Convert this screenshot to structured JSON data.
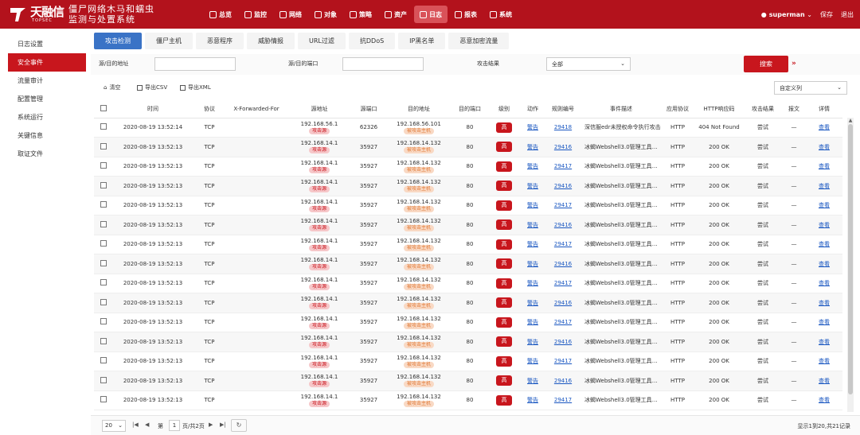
{
  "brand": {
    "logo_cn": "天融信",
    "logo_en": "TOPSEC",
    "product_line1": "僵尸网络木马和蠕虫",
    "product_line2": "监测与处置系统",
    "color": "#b3121c"
  },
  "topnav": [
    {
      "label": "总览",
      "icon": "dashboard-icon"
    },
    {
      "label": "监控",
      "icon": "monitor-icon"
    },
    {
      "label": "网络",
      "icon": "network-icon"
    },
    {
      "label": "对象",
      "icon": "object-icon"
    },
    {
      "label": "策略",
      "icon": "shield-icon"
    },
    {
      "label": "资产",
      "icon": "asset-icon"
    },
    {
      "label": "日志",
      "icon": "log-icon",
      "active": true
    },
    {
      "label": "报表",
      "icon": "report-icon"
    },
    {
      "label": "系统",
      "icon": "gear-icon"
    }
  ],
  "user": {
    "name": "superman",
    "save": "保存",
    "logout": "退出"
  },
  "sidebar": [
    {
      "label": "日志设置"
    },
    {
      "label": "安全事件",
      "active": true
    },
    {
      "label": "流量审计"
    },
    {
      "label": "配置管理"
    },
    {
      "label": "系统运行"
    },
    {
      "label": "关键信息"
    },
    {
      "label": "取证文件"
    }
  ],
  "tabs": [
    {
      "label": "攻击检测",
      "active": true
    },
    {
      "label": "僵尸主机"
    },
    {
      "label": "恶意程序"
    },
    {
      "label": "威胁情报"
    },
    {
      "label": "URL过滤"
    },
    {
      "label": "抗DDoS"
    },
    {
      "label": "IP黑名单"
    },
    {
      "label": "恶意加密流量"
    }
  ],
  "filter": {
    "src_dst_addr_label": "源/目的地址",
    "src_dst_port_label": "源/目的端口",
    "result_label": "攻击结果",
    "result_value": "全部",
    "search": "搜索"
  },
  "toolbar": {
    "clear": "清空",
    "export_csv": "导出CSV",
    "export_xml": "导出XML",
    "custom_columns": "自定义列"
  },
  "columns": [
    "时间",
    "协议",
    "X-Forwarded-For",
    "源地址",
    "源端口",
    "目的地址",
    "目的端口",
    "级别",
    "动作",
    "规则编号",
    "事件描述",
    "应用协议",
    "HTTP响应码",
    "攻击结果",
    "报文",
    "详情"
  ],
  "rows": [
    {
      "time": "2020-08-19 13:52:14",
      "proto": "TCP",
      "xff": "",
      "src": "192.168.56.1",
      "src_tag": "攻击源",
      "sport": "62326",
      "dst": "192.168.56.101",
      "dst_tag": "被攻击主机",
      "dport": "80",
      "level": "高",
      "action": "警告",
      "rule": "29418",
      "desc": "深信服edr未授权命令执行攻击",
      "app": "HTTP",
      "code": "404 Not Found",
      "result": "尝试",
      "packet": "—",
      "detail": "查看"
    },
    {
      "time": "2020-08-19 13:52:13",
      "proto": "TCP",
      "xff": "",
      "src": "192.168.14.1",
      "src_tag": "攻击源",
      "sport": "35927",
      "dst": "192.168.14.132",
      "dst_tag": "被攻击主机",
      "dport": "80",
      "level": "高",
      "action": "警告",
      "rule": "29416",
      "desc": "冰蝎Webshell3.0管理工具连...",
      "app": "HTTP",
      "code": "200 OK",
      "result": "尝试",
      "packet": "—",
      "detail": "查看"
    },
    {
      "time": "2020-08-19 13:52:13",
      "proto": "TCP",
      "xff": "",
      "src": "192.168.14.1",
      "src_tag": "攻击源",
      "sport": "35927",
      "dst": "192.168.14.132",
      "dst_tag": "被攻击主机",
      "dport": "80",
      "level": "高",
      "action": "警告",
      "rule": "29417",
      "desc": "冰蝎Webshell3.0管理工具连...",
      "app": "HTTP",
      "code": "200 OK",
      "result": "尝试",
      "packet": "—",
      "detail": "查看"
    },
    {
      "time": "2020-08-19 13:52:13",
      "proto": "TCP",
      "xff": "",
      "src": "192.168.14.1",
      "src_tag": "攻击源",
      "sport": "35927",
      "dst": "192.168.14.132",
      "dst_tag": "被攻击主机",
      "dport": "80",
      "level": "高",
      "action": "警告",
      "rule": "29416",
      "desc": "冰蝎Webshell3.0管理工具连...",
      "app": "HTTP",
      "code": "200 OK",
      "result": "尝试",
      "packet": "—",
      "detail": "查看"
    },
    {
      "time": "2020-08-19 13:52:13",
      "proto": "TCP",
      "xff": "",
      "src": "192.168.14.1",
      "src_tag": "攻击源",
      "sport": "35927",
      "dst": "192.168.14.132",
      "dst_tag": "被攻击主机",
      "dport": "80",
      "level": "高",
      "action": "警告",
      "rule": "29417",
      "desc": "冰蝎Webshell3.0管理工具连...",
      "app": "HTTP",
      "code": "200 OK",
      "result": "尝试",
      "packet": "—",
      "detail": "查看"
    },
    {
      "time": "2020-08-19 13:52:13",
      "proto": "TCP",
      "xff": "",
      "src": "192.168.14.1",
      "src_tag": "攻击源",
      "sport": "35927",
      "dst": "192.168.14.132",
      "dst_tag": "被攻击主机",
      "dport": "80",
      "level": "高",
      "action": "警告",
      "rule": "29416",
      "desc": "冰蝎Webshell3.0管理工具连...",
      "app": "HTTP",
      "code": "200 OK",
      "result": "尝试",
      "packet": "—",
      "detail": "查看"
    },
    {
      "time": "2020-08-19 13:52:13",
      "proto": "TCP",
      "xff": "",
      "src": "192.168.14.1",
      "src_tag": "攻击源",
      "sport": "35927",
      "dst": "192.168.14.132",
      "dst_tag": "被攻击主机",
      "dport": "80",
      "level": "高",
      "action": "警告",
      "rule": "29417",
      "desc": "冰蝎Webshell3.0管理工具连...",
      "app": "HTTP",
      "code": "200 OK",
      "result": "尝试",
      "packet": "—",
      "detail": "查看"
    },
    {
      "time": "2020-08-19 13:52:13",
      "proto": "TCP",
      "xff": "",
      "src": "192.168.14.1",
      "src_tag": "攻击源",
      "sport": "35927",
      "dst": "192.168.14.132",
      "dst_tag": "被攻击主机",
      "dport": "80",
      "level": "高",
      "action": "警告",
      "rule": "29416",
      "desc": "冰蝎Webshell3.0管理工具连...",
      "app": "HTTP",
      "code": "200 OK",
      "result": "尝试",
      "packet": "—",
      "detail": "查看"
    },
    {
      "time": "2020-08-19 13:52:13",
      "proto": "TCP",
      "xff": "",
      "src": "192.168.14.1",
      "src_tag": "攻击源",
      "sport": "35927",
      "dst": "192.168.14.132",
      "dst_tag": "被攻击主机",
      "dport": "80",
      "level": "高",
      "action": "警告",
      "rule": "29417",
      "desc": "冰蝎Webshell3.0管理工具连...",
      "app": "HTTP",
      "code": "200 OK",
      "result": "尝试",
      "packet": "—",
      "detail": "查看"
    },
    {
      "time": "2020-08-19 13:52:13",
      "proto": "TCP",
      "xff": "",
      "src": "192.168.14.1",
      "src_tag": "攻击源",
      "sport": "35927",
      "dst": "192.168.14.132",
      "dst_tag": "被攻击主机",
      "dport": "80",
      "level": "高",
      "action": "警告",
      "rule": "29416",
      "desc": "冰蝎Webshell3.0管理工具连...",
      "app": "HTTP",
      "code": "200 OK",
      "result": "尝试",
      "packet": "—",
      "detail": "查看"
    },
    {
      "time": "2020-08-19 13:52:13",
      "proto": "TCP",
      "xff": "",
      "src": "192.168.14.1",
      "src_tag": "攻击源",
      "sport": "35927",
      "dst": "192.168.14.132",
      "dst_tag": "被攻击主机",
      "dport": "80",
      "level": "高",
      "action": "警告",
      "rule": "29417",
      "desc": "冰蝎Webshell3.0管理工具连...",
      "app": "HTTP",
      "code": "200 OK",
      "result": "尝试",
      "packet": "—",
      "detail": "查看"
    },
    {
      "time": "2020-08-19 13:52:13",
      "proto": "TCP",
      "xff": "",
      "src": "192.168.14.1",
      "src_tag": "攻击源",
      "sport": "35927",
      "dst": "192.168.14.132",
      "dst_tag": "被攻击主机",
      "dport": "80",
      "level": "高",
      "action": "警告",
      "rule": "29416",
      "desc": "冰蝎Webshell3.0管理工具连...",
      "app": "HTTP",
      "code": "200 OK",
      "result": "尝试",
      "packet": "—",
      "detail": "查看"
    },
    {
      "time": "2020-08-19 13:52:13",
      "proto": "TCP",
      "xff": "",
      "src": "192.168.14.1",
      "src_tag": "攻击源",
      "sport": "35927",
      "dst": "192.168.14.132",
      "dst_tag": "被攻击主机",
      "dport": "80",
      "level": "高",
      "action": "警告",
      "rule": "29417",
      "desc": "冰蝎Webshell3.0管理工具连...",
      "app": "HTTP",
      "code": "200 OK",
      "result": "尝试",
      "packet": "—",
      "detail": "查看"
    },
    {
      "time": "2020-08-19 13:52:13",
      "proto": "TCP",
      "xff": "",
      "src": "192.168.14.1",
      "src_tag": "攻击源",
      "sport": "35927",
      "dst": "192.168.14.132",
      "dst_tag": "被攻击主机",
      "dport": "80",
      "level": "高",
      "action": "警告",
      "rule": "29416",
      "desc": "冰蝎Webshell3.0管理工具连...",
      "app": "HTTP",
      "code": "200 OK",
      "result": "尝试",
      "packet": "—",
      "detail": "查看"
    },
    {
      "time": "2020-08-19 13:52:13",
      "proto": "TCP",
      "xff": "",
      "src": "192.168.14.1",
      "src_tag": "攻击源",
      "sport": "35927",
      "dst": "192.168.14.132",
      "dst_tag": "被攻击主机",
      "dport": "80",
      "level": "高",
      "action": "警告",
      "rule": "29417",
      "desc": "冰蝎Webshell3.0管理工具连...",
      "app": "HTTP",
      "code": "200 OK",
      "result": "尝试",
      "packet": "—",
      "detail": "查看"
    }
  ],
  "pager": {
    "page_size": "20",
    "page_prefix": "第",
    "page": "1",
    "page_suffix": "页/共2页",
    "info": "显示1到20,共21记录"
  },
  "colors": {
    "accent": "#c8161d",
    "tab_active": "#3a73c6",
    "link": "#1a57c1"
  }
}
